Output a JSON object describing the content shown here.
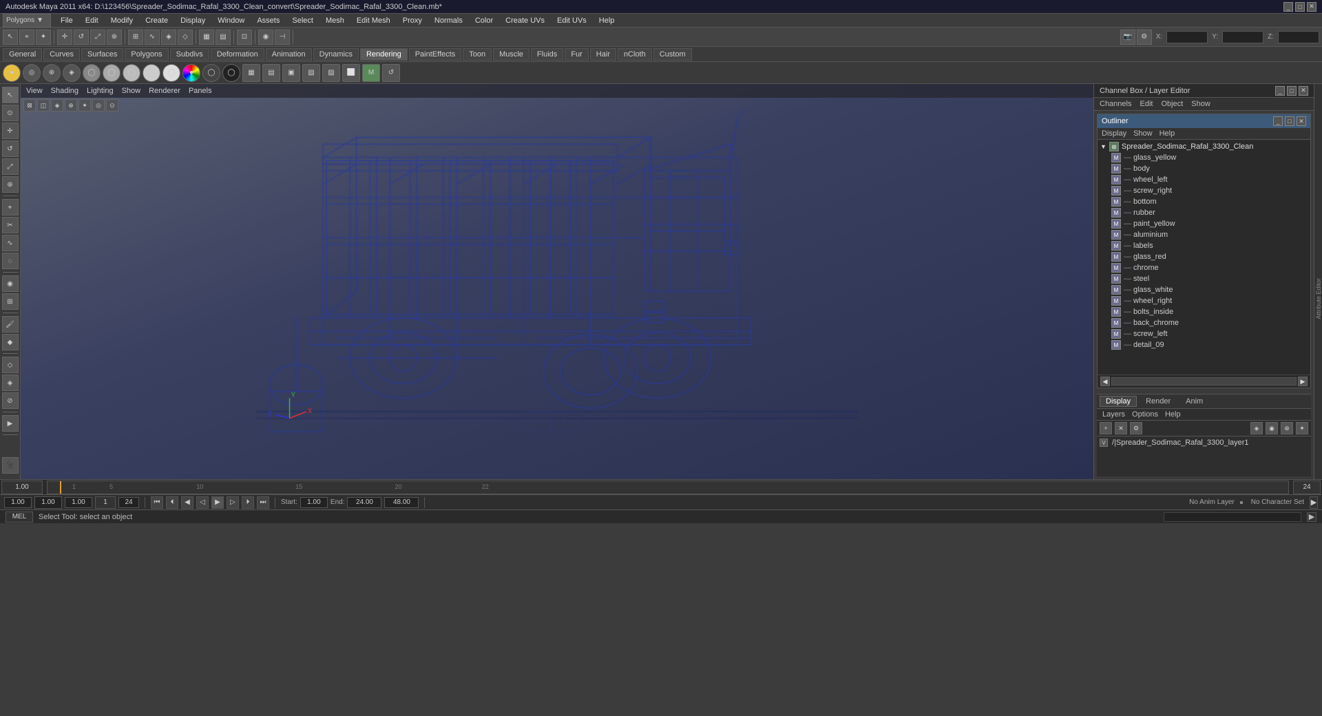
{
  "title_bar": {
    "text": "Autodesk Maya 2011 x64: D:\\123456\\Spreader_Sodimac_Rafal_3300_Clean_convert\\Spreader_Sodimac_Rafal_3300_Clean.mb*"
  },
  "menu_bar": {
    "context": "Polygons",
    "items": [
      "File",
      "Edit",
      "Modify",
      "Create",
      "Display",
      "Window",
      "Assets",
      "Select",
      "Mesh",
      "Edit Mesh",
      "Proxy",
      "Normals",
      "Color",
      "Create UVs",
      "Edit UVs",
      "Help"
    ]
  },
  "shelf_tabs": {
    "tabs": [
      "General",
      "Curves",
      "Surfaces",
      "Polygons",
      "Subdivs",
      "Deformation",
      "Animation",
      "Dynamics",
      "Rendering",
      "PaintEffects",
      "Toon",
      "Muscle",
      "Fluids",
      "Fur",
      "Hair",
      "nCloth",
      "Custom"
    ],
    "active": "Rendering"
  },
  "viewport": {
    "menu_items": [
      "View",
      "Shading",
      "Lighting",
      "Show",
      "Renderer",
      "Panels"
    ]
  },
  "right_panel": {
    "title": "Channel Box / Layer Editor",
    "cb_tabs": [
      "Channels",
      "Edit",
      "Object",
      "Show"
    ]
  },
  "outliner": {
    "title": "Outliner",
    "menu": [
      "Display",
      "Show",
      "Help"
    ],
    "root": "Spreader_Sodimac_Rafal_3300_Clean",
    "items": [
      "glass_yellow",
      "body",
      "wheel_left",
      "screw_right",
      "bottom",
      "rubber",
      "paint_yellow",
      "aluminium",
      "labels",
      "glass_red",
      "chrome",
      "steel",
      "glass_white",
      "wheel_right",
      "bolts_inside",
      "back_chrome",
      "screw_left",
      "detail_09"
    ]
  },
  "layer_editor": {
    "tabs": [
      "Display",
      "Render",
      "Anim"
    ],
    "active_tab": "Display",
    "subtabs": [
      "Layers",
      "Options",
      "Help"
    ],
    "layer": {
      "v_label": "V",
      "name": "/|Spreader_Sodimac_Rafal_3300_layer1"
    }
  },
  "timeline": {
    "start": "1.00",
    "end": "24.00",
    "current": "1",
    "range_end": "24",
    "ticks": [
      "1",
      "5",
      "10",
      "15",
      "20",
      "22"
    ],
    "current_frame": "1.00",
    "range_start_field": "1.00",
    "range_end_field": "24.00",
    "anim_end": "48.00"
  },
  "transport": {
    "current_frame": "1.00",
    "anim_layer": "No Anim Layer",
    "character_set": "No Character Set",
    "buttons": [
      "⏮",
      "⏪",
      "⏴",
      "▶",
      "⏵",
      "⏩",
      "⏭"
    ]
  },
  "status_bar": {
    "mode": "MEL",
    "message": "Select Tool: select an object"
  },
  "attr_strip": {
    "label": "Attribute Editor"
  }
}
